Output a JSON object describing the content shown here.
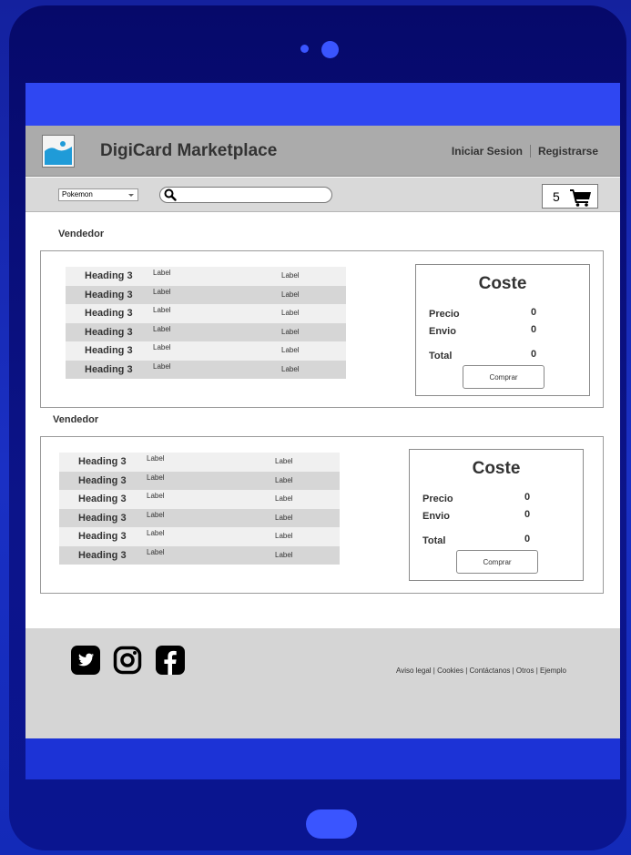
{
  "header": {
    "brand": "DigiCard Marketplace",
    "login": "Iniciar Sesion",
    "register": "Registrarse"
  },
  "toolbar": {
    "category": "Pokemon",
    "search_value": "",
    "cart_count": "5"
  },
  "vendors": [
    {
      "label": "Vendedor",
      "rows": [
        {
          "heading": "Heading 3",
          "col1": "Label",
          "col2": "Label"
        },
        {
          "heading": "Heading 3",
          "col1": "Label",
          "col2": "Label"
        },
        {
          "heading": "Heading 3",
          "col1": "Label",
          "col2": "Label"
        },
        {
          "heading": "Heading 3",
          "col1": "Label",
          "col2": "Label"
        },
        {
          "heading": "Heading 3",
          "col1": "Label",
          "col2": "Label"
        },
        {
          "heading": "Heading 3",
          "col1": "Label",
          "col2": "Label"
        }
      ],
      "cost": {
        "title": "Coste",
        "precio_label": "Precio",
        "precio": "0",
        "envio_label": "Envio",
        "envio": "0",
        "total_label": "Total",
        "total": "0",
        "button": "Comprar"
      }
    },
    {
      "label": "Vendedor",
      "rows": [
        {
          "heading": "Heading 3",
          "col1": "Label",
          "col2": "Label"
        },
        {
          "heading": "Heading 3",
          "col1": "Label",
          "col2": "Label"
        },
        {
          "heading": "Heading 3",
          "col1": "Label",
          "col2": "Label"
        },
        {
          "heading": "Heading 3",
          "col1": "Label",
          "col2": "Label"
        },
        {
          "heading": "Heading 3",
          "col1": "Label",
          "col2": "Label"
        },
        {
          "heading": "Heading 3",
          "col1": "Label",
          "col2": "Label"
        }
      ],
      "cost": {
        "title": "Coste",
        "precio_label": "Precio",
        "precio": "0",
        "envio_label": "Envio",
        "envio": "0",
        "total_label": "Total",
        "total": "0",
        "button": "Comprar"
      }
    }
  ],
  "footer": {
    "social": [
      "twitter-icon",
      "instagram-icon",
      "facebook-icon"
    ],
    "links": "Aviso legal | Cookies | Contáctanos | Otros | Ejemplo"
  },
  "colors": {
    "background": "#1a30c4",
    "tablet": "#06096a",
    "accent": "#3a55ff",
    "header": "#ababab",
    "toolbar": "#d9d9d9",
    "footer": "#d5d5d5"
  }
}
